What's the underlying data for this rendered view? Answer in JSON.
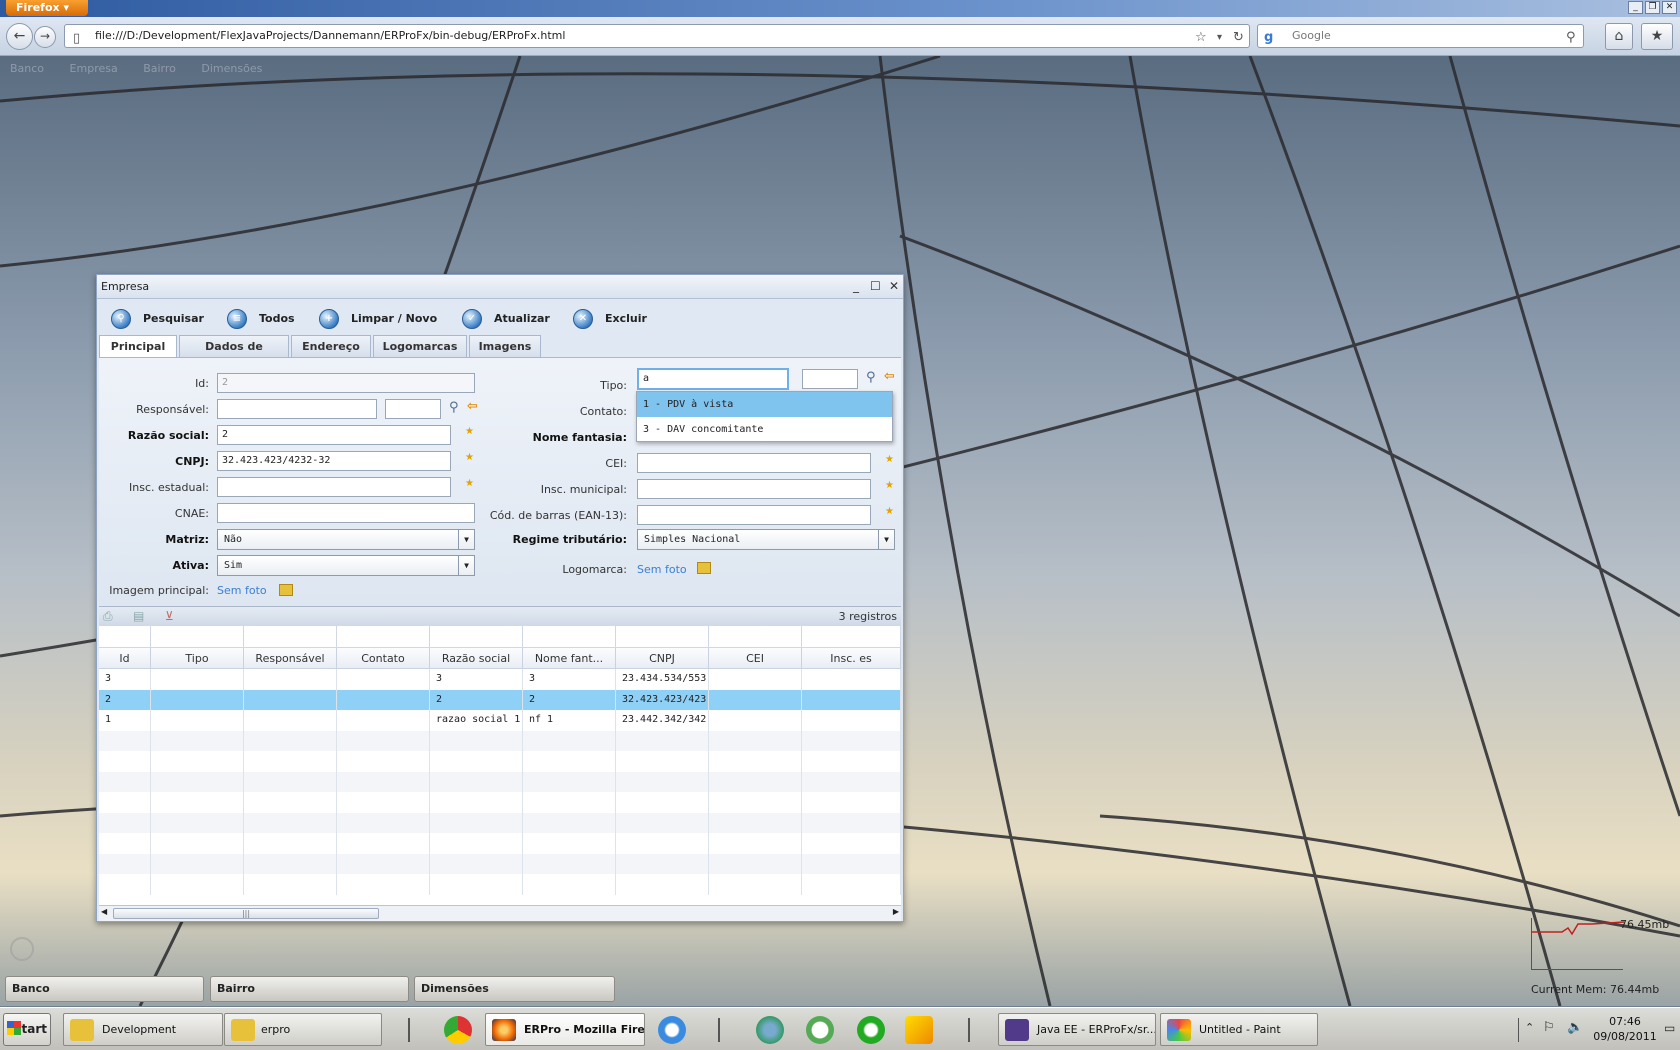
{
  "browser": {
    "menu_label": "Firefox",
    "url": "file:///D:/Development/FlexJavaProjects/Dannemann/ERProFx/bin-debug/ERProFx.html",
    "search_placeholder": "Google"
  },
  "top_nav": {
    "items": [
      "Banco",
      "Empresa",
      "Bairro",
      "Dimensões"
    ]
  },
  "window": {
    "title": "Empresa",
    "toolbar": [
      "Pesquisar",
      "Todos",
      "Limpar / Novo",
      "Atualizar",
      "Excluir"
    ],
    "tabs": [
      "Principal",
      "Dados de contato",
      "Endereço",
      "Logomarcas",
      "Imagens"
    ],
    "active_tab": "Principal"
  },
  "form": {
    "labels": {
      "id": "Id:",
      "responsavel": "Responsável:",
      "razao_social": "Razão social:",
      "cnpj": "CNPJ:",
      "insc_estadual": "Insc. estadual:",
      "cnae": "CNAE:",
      "matriz": "Matriz:",
      "ativa": "Ativa:",
      "imagem_principal": "Imagem principal:",
      "tipo": "Tipo:",
      "contato": "Contato:",
      "nome_fantasia": "Nome fantasia:",
      "cei": "CEI:",
      "insc_municipal": "Insc. municipal:",
      "cod_barras": "Cód. de barras (EAN-13):",
      "regime": "Regime tributário:",
      "logomarca": "Logomarca:"
    },
    "values": {
      "id": "2",
      "razao_social": "2",
      "cnpj": "32.423.423/4232-32",
      "matriz": "Não",
      "ativa": "Sim",
      "tipo": "a",
      "regime": "Simples Nacional",
      "sem_foto": "Sem foto"
    },
    "tipo_options": [
      "1 - PDV à vista",
      "3 - DAV concomitante"
    ]
  },
  "grid": {
    "count": "3 registros",
    "columns": [
      "Id",
      "Tipo",
      "Responsável",
      "Contato",
      "Razão social",
      "Nome fant...",
      "CNPJ",
      "CEI",
      "Insc. es"
    ],
    "rows": [
      [
        "3",
        "",
        "",
        "",
        "3",
        "3",
        "23.434.534/553",
        "",
        ""
      ],
      [
        "2",
        "",
        "",
        "",
        "2",
        "2",
        "32.423.423/423",
        "",
        ""
      ],
      [
        "1",
        "",
        "",
        "",
        "razao social 1",
        "nf 1",
        "23.442.342/342",
        "",
        ""
      ]
    ],
    "selected_row": 1
  },
  "memory": {
    "peak": "76.45mb",
    "current": "Current Mem: 76.44mb"
  },
  "dock": [
    "Banco",
    "Bairro",
    "Dimensões"
  ],
  "taskbar": {
    "start": "Start",
    "items": [
      "Development",
      "erpro",
      "ERPro - Mozilla Fire...",
      "Java EE - ERProFx/sr...",
      "Untitled - Paint"
    ],
    "time": "07:46",
    "date": "09/08/2011"
  },
  "colors": {
    "accent": "#3c7fd1",
    "selection": "#8fd0f6",
    "window_bg": "#dfe8f3"
  }
}
